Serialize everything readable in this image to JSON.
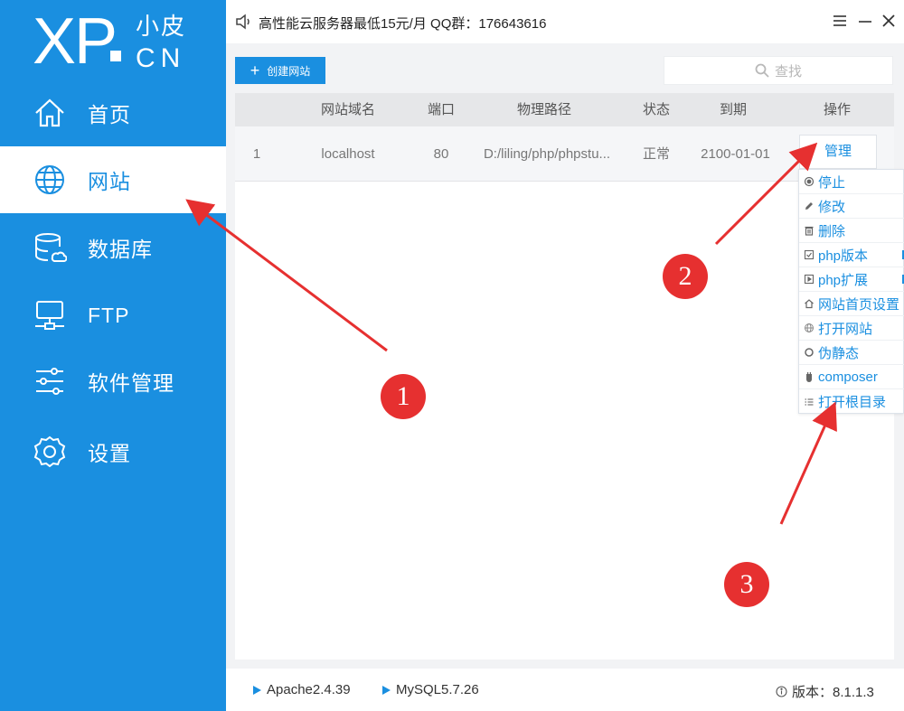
{
  "sidebar": {
    "logo": {
      "main": "XP",
      "cn_top": "小皮",
      "cn_bottom": "CN"
    },
    "items": [
      {
        "label": "首页",
        "icon": "home-icon",
        "active": false
      },
      {
        "label": "网站",
        "icon": "globe-icon",
        "active": true
      },
      {
        "label": "数据库",
        "icon": "database-icon",
        "active": false
      },
      {
        "label": "FTP",
        "icon": "ftp-icon",
        "active": false
      },
      {
        "label": "软件管理",
        "icon": "sliders-icon",
        "active": false
      },
      {
        "label": "设置",
        "icon": "gear-icon",
        "active": false
      }
    ]
  },
  "titlebar": {
    "notice": "高性能云服务器最低15元/月  QQ群：176643616",
    "buttons": [
      "menu-icon",
      "minimize-icon",
      "close-icon"
    ]
  },
  "toolbar": {
    "create_label": "创建网站",
    "search_placeholder": "查找"
  },
  "table": {
    "columns": [
      "网站域名",
      "端口",
      "物理路径",
      "状态",
      "到期",
      "操作"
    ],
    "rows": [
      {
        "index": "1",
        "domain": "localhost",
        "port": "80",
        "path": "D:/liling/php/phpstu...",
        "status": "正常",
        "expiry": "2100-01-01",
        "action": "管理"
      }
    ]
  },
  "dropdown": {
    "items": [
      {
        "label": "停止",
        "icon": "stop-icon"
      },
      {
        "label": "修改",
        "icon": "edit-icon"
      },
      {
        "label": "删除",
        "icon": "trash-icon"
      },
      {
        "label": "php版本",
        "icon": "php-version-icon",
        "submenu": true
      },
      {
        "label": "php扩展",
        "icon": "php-extension-icon",
        "submenu": true
      },
      {
        "label": "网站首页设置",
        "icon": "home-small-icon"
      },
      {
        "label": "打开网站",
        "icon": "globe-small-icon"
      },
      {
        "label": "伪静态",
        "icon": "rewrite-icon"
      },
      {
        "label": "composer",
        "icon": "composer-icon"
      },
      {
        "label": "打开根目录",
        "icon": "list-icon"
      }
    ]
  },
  "footer": {
    "services": [
      "Apache2.4.39",
      "MySQL5.7.26"
    ],
    "version": "版本：8.1.1.3"
  },
  "annotations": [
    "1",
    "2",
    "3"
  ],
  "colors": {
    "accent": "#1a8fe0",
    "annotation": "#e63030"
  }
}
